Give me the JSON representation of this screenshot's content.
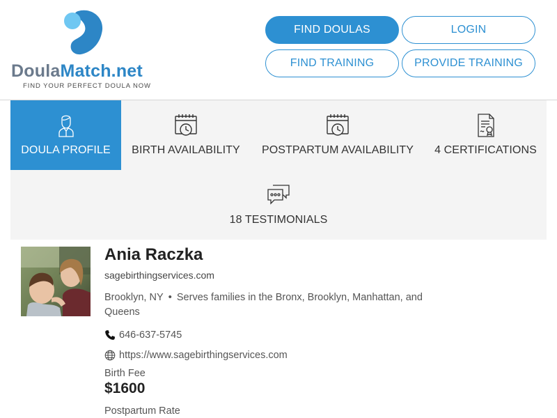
{
  "brand": {
    "word_part1": "Doula",
    "word_part2": "Match.net",
    "tagline": "FIND YOUR PERFECT DOULA NOW",
    "primary_color": "#2d90d2"
  },
  "nav": {
    "find_doulas": "FIND DOULAS",
    "login": "LOGIN",
    "find_training": "FIND TRAINING",
    "provide_training": "PROVIDE TRAINING"
  },
  "tabs": [
    {
      "label": "DOULA PROFILE",
      "icon": "doula-person-icon",
      "active": true
    },
    {
      "label": "BIRTH AVAILABILITY",
      "icon": "calendar-clock-icon"
    },
    {
      "label": "POSTPARTUM AVAILABILITY",
      "icon": "calendar-clock-icon"
    },
    {
      "label": "4 CERTIFICATIONS",
      "icon": "certificate-document-icon"
    },
    {
      "label": "18 TESTIMONIALS",
      "icon": "chat-bubbles-icon"
    }
  ],
  "profile": {
    "name": "Ania Raczka",
    "website_short": "sagebirthingservices.com",
    "location": "Brooklyn, NY",
    "serves": "Serves families in the Bronx, Brooklyn, Manhattan, and Queens",
    "phone": "646-637-5745",
    "website_url": "https://www.sagebirthingservices.com",
    "birth_fee_label": "Birth Fee",
    "birth_fee": "$1600",
    "postpartum_rate_label": "Postpartum Rate"
  }
}
